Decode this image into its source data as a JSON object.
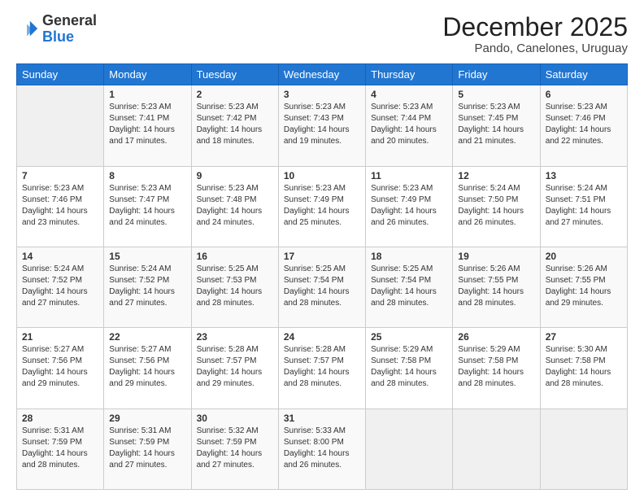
{
  "logo": {
    "general": "General",
    "blue": "Blue"
  },
  "header": {
    "month": "December 2025",
    "location": "Pando, Canelones, Uruguay"
  },
  "weekdays": [
    "Sunday",
    "Monday",
    "Tuesday",
    "Wednesday",
    "Thursday",
    "Friday",
    "Saturday"
  ],
  "weeks": [
    [
      {
        "day": "",
        "info": ""
      },
      {
        "day": "1",
        "info": "Sunrise: 5:23 AM\nSunset: 7:41 PM\nDaylight: 14 hours\nand 17 minutes."
      },
      {
        "day": "2",
        "info": "Sunrise: 5:23 AM\nSunset: 7:42 PM\nDaylight: 14 hours\nand 18 minutes."
      },
      {
        "day": "3",
        "info": "Sunrise: 5:23 AM\nSunset: 7:43 PM\nDaylight: 14 hours\nand 19 minutes."
      },
      {
        "day": "4",
        "info": "Sunrise: 5:23 AM\nSunset: 7:44 PM\nDaylight: 14 hours\nand 20 minutes."
      },
      {
        "day": "5",
        "info": "Sunrise: 5:23 AM\nSunset: 7:45 PM\nDaylight: 14 hours\nand 21 minutes."
      },
      {
        "day": "6",
        "info": "Sunrise: 5:23 AM\nSunset: 7:46 PM\nDaylight: 14 hours\nand 22 minutes."
      }
    ],
    [
      {
        "day": "7",
        "info": "Sunrise: 5:23 AM\nSunset: 7:46 PM\nDaylight: 14 hours\nand 23 minutes."
      },
      {
        "day": "8",
        "info": "Sunrise: 5:23 AM\nSunset: 7:47 PM\nDaylight: 14 hours\nand 24 minutes."
      },
      {
        "day": "9",
        "info": "Sunrise: 5:23 AM\nSunset: 7:48 PM\nDaylight: 14 hours\nand 24 minutes."
      },
      {
        "day": "10",
        "info": "Sunrise: 5:23 AM\nSunset: 7:49 PM\nDaylight: 14 hours\nand 25 minutes."
      },
      {
        "day": "11",
        "info": "Sunrise: 5:23 AM\nSunset: 7:49 PM\nDaylight: 14 hours\nand 26 minutes."
      },
      {
        "day": "12",
        "info": "Sunrise: 5:24 AM\nSunset: 7:50 PM\nDaylight: 14 hours\nand 26 minutes."
      },
      {
        "day": "13",
        "info": "Sunrise: 5:24 AM\nSunset: 7:51 PM\nDaylight: 14 hours\nand 27 minutes."
      }
    ],
    [
      {
        "day": "14",
        "info": "Sunrise: 5:24 AM\nSunset: 7:52 PM\nDaylight: 14 hours\nand 27 minutes."
      },
      {
        "day": "15",
        "info": "Sunrise: 5:24 AM\nSunset: 7:52 PM\nDaylight: 14 hours\nand 27 minutes."
      },
      {
        "day": "16",
        "info": "Sunrise: 5:25 AM\nSunset: 7:53 PM\nDaylight: 14 hours\nand 28 minutes."
      },
      {
        "day": "17",
        "info": "Sunrise: 5:25 AM\nSunset: 7:54 PM\nDaylight: 14 hours\nand 28 minutes."
      },
      {
        "day": "18",
        "info": "Sunrise: 5:25 AM\nSunset: 7:54 PM\nDaylight: 14 hours\nand 28 minutes."
      },
      {
        "day": "19",
        "info": "Sunrise: 5:26 AM\nSunset: 7:55 PM\nDaylight: 14 hours\nand 28 minutes."
      },
      {
        "day": "20",
        "info": "Sunrise: 5:26 AM\nSunset: 7:55 PM\nDaylight: 14 hours\nand 29 minutes."
      }
    ],
    [
      {
        "day": "21",
        "info": "Sunrise: 5:27 AM\nSunset: 7:56 PM\nDaylight: 14 hours\nand 29 minutes."
      },
      {
        "day": "22",
        "info": "Sunrise: 5:27 AM\nSunset: 7:56 PM\nDaylight: 14 hours\nand 29 minutes."
      },
      {
        "day": "23",
        "info": "Sunrise: 5:28 AM\nSunset: 7:57 PM\nDaylight: 14 hours\nand 29 minutes."
      },
      {
        "day": "24",
        "info": "Sunrise: 5:28 AM\nSunset: 7:57 PM\nDaylight: 14 hours\nand 28 minutes."
      },
      {
        "day": "25",
        "info": "Sunrise: 5:29 AM\nSunset: 7:58 PM\nDaylight: 14 hours\nand 28 minutes."
      },
      {
        "day": "26",
        "info": "Sunrise: 5:29 AM\nSunset: 7:58 PM\nDaylight: 14 hours\nand 28 minutes."
      },
      {
        "day": "27",
        "info": "Sunrise: 5:30 AM\nSunset: 7:58 PM\nDaylight: 14 hours\nand 28 minutes."
      }
    ],
    [
      {
        "day": "28",
        "info": "Sunrise: 5:31 AM\nSunset: 7:59 PM\nDaylight: 14 hours\nand 28 minutes."
      },
      {
        "day": "29",
        "info": "Sunrise: 5:31 AM\nSunset: 7:59 PM\nDaylight: 14 hours\nand 27 minutes."
      },
      {
        "day": "30",
        "info": "Sunrise: 5:32 AM\nSunset: 7:59 PM\nDaylight: 14 hours\nand 27 minutes."
      },
      {
        "day": "31",
        "info": "Sunrise: 5:33 AM\nSunset: 8:00 PM\nDaylight: 14 hours\nand 26 minutes."
      },
      {
        "day": "",
        "info": ""
      },
      {
        "day": "",
        "info": ""
      },
      {
        "day": "",
        "info": ""
      }
    ]
  ]
}
